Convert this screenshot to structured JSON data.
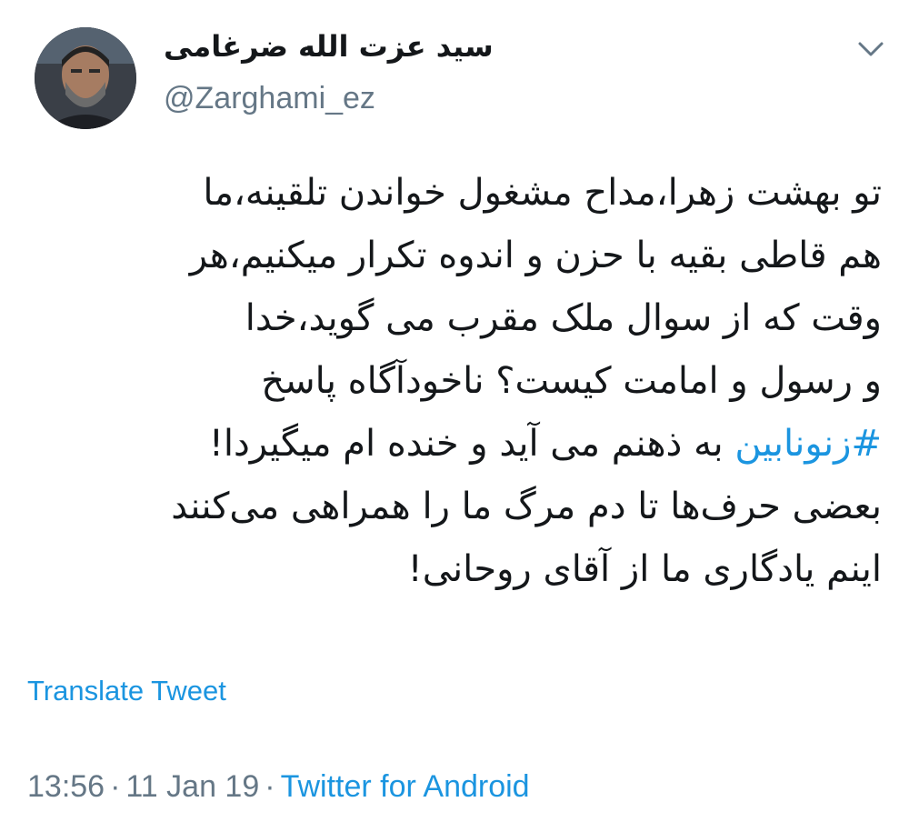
{
  "author": {
    "display_name": "سید عزت الله ضرغامی",
    "handle": "@Zarghami_ez",
    "avatar_icon": "profile-photo"
  },
  "menu": {
    "icon": "chevron-down-icon"
  },
  "tweet": {
    "lines": [
      {
        "text": "تو بهشت زهرا،مداح مشغول خواندن تلقینه،ما"
      },
      {
        "text": "هم قاطی بقیه با حزن و اندوه تکرار میکنیم،هر"
      },
      {
        "text": "وقت که از سوال ملک مقرب می گوید،خدا"
      },
      {
        "text": "و رسول و امامت کیست؟ ناخودآگاه پاسخ"
      },
      {
        "hashtag": "#زنونابین",
        "rest": " به ذهنم می آید و خنده ام میگیردا!"
      },
      {
        "text": "بعضی حرف‌ها تا دم مرگ ما را همراهی می‌کنند"
      },
      {
        "text": "اینم یادگاری ما از آقای روحانی!"
      }
    ]
  },
  "translate_label": "Translate Tweet",
  "meta": {
    "time": "13:56",
    "separator": "·",
    "date": "11 Jan 19",
    "source": "Twitter for Android"
  },
  "colors": {
    "link": "#1b95e0",
    "secondary_text": "#657786",
    "primary_text": "#14171a"
  }
}
